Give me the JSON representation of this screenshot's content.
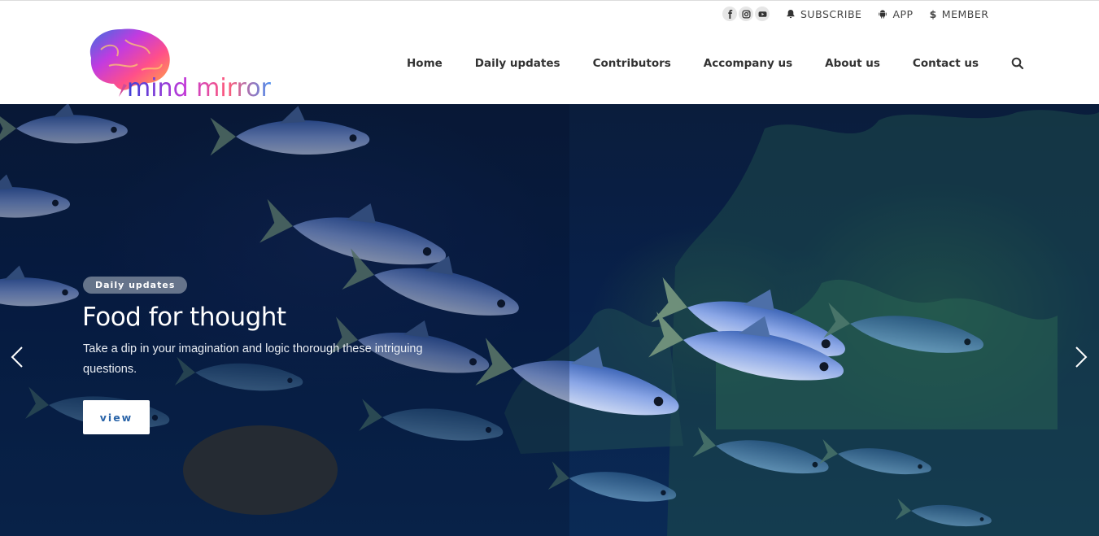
{
  "header": {
    "logo_text": "mind mirror",
    "social": [
      {
        "icon": "facebook-icon"
      },
      {
        "icon": "instagram-icon"
      },
      {
        "icon": "youtube-icon"
      }
    ],
    "utility": {
      "subscribe": "SUBSCRIBE",
      "app": "APP",
      "member_symbol": "$",
      "member": "MEMBER"
    },
    "nav": [
      "Home",
      "Daily updates",
      "Contributors",
      "Accompany us",
      "About us",
      "Contact us"
    ]
  },
  "hero": {
    "badge": "Daily updates",
    "title": "Food for thought",
    "text": "Take a dip in your imagination and logic thorough these intriguing questions.",
    "button": "view"
  }
}
